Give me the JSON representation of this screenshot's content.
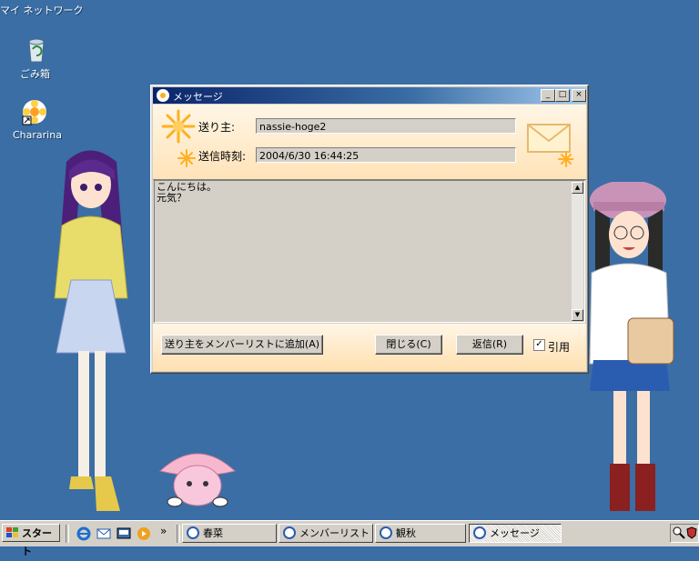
{
  "desktop": {
    "network_label": "マイ ネットワーク",
    "recycle_label": "ごみ箱",
    "chararina_label": "Chararina"
  },
  "window": {
    "title": "メッセージ",
    "from_label": "送り主:",
    "from_value": "nassie-hoge2",
    "time_label": "送信時刻:",
    "time_value": "2004/6/30 16:44:25",
    "message_body": "こんにちは。\n元気？",
    "add_member_button": "送り主をメンバーリストに追加(A)",
    "close_button": "閉じる(C)",
    "reply_button": "返信(R)",
    "quote_label": "引用",
    "quote_checked": true,
    "minimize": "_",
    "maximize": "□",
    "close": "×"
  },
  "taskbar": {
    "start_label": "スタート",
    "chevron": "»",
    "tasks": [
      {
        "label": "春菜",
        "active": false
      },
      {
        "label": "メンバーリスト",
        "active": false
      },
      {
        "label": "観秋",
        "active": false
      },
      {
        "label": "メッセージ",
        "active": true
      }
    ]
  },
  "colors": {
    "desktop": "#3a6ea5",
    "title_active": "#0a246a",
    "header_bg": "#ffe3b8"
  }
}
